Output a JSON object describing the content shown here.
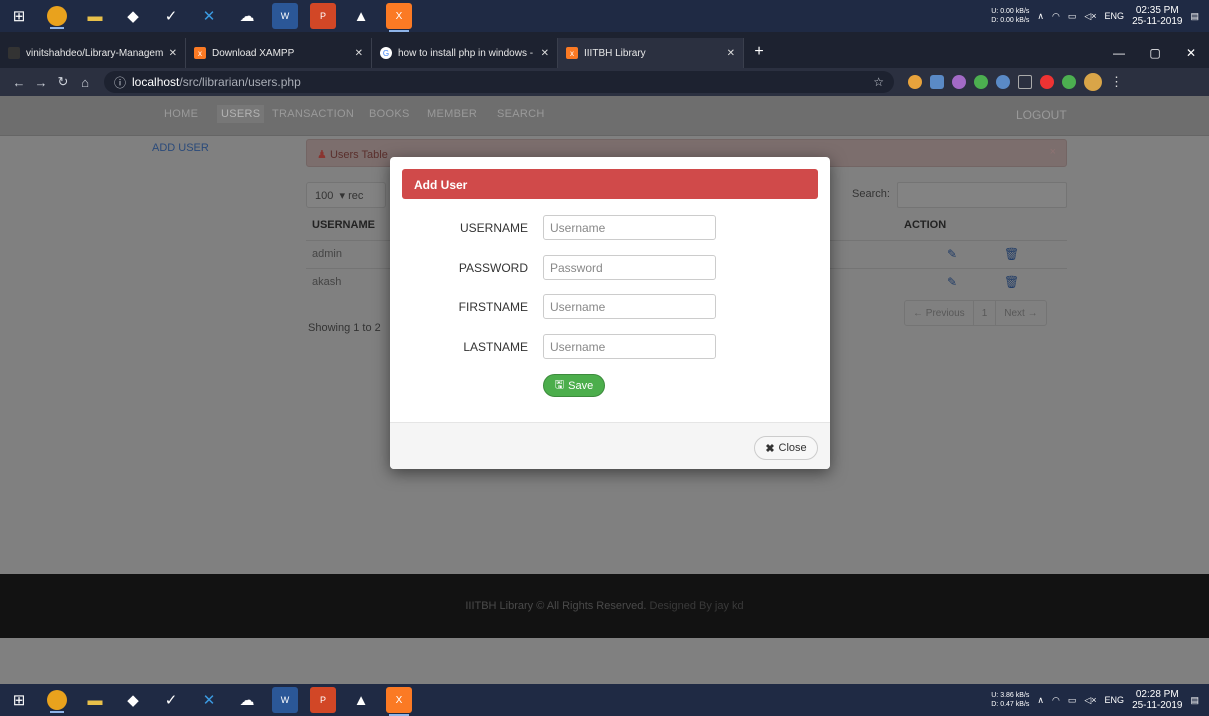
{
  "taskbar_top": {
    "net_up": "0.00 kB/s",
    "net_down": "0.00 kB/s",
    "lang": "ENG",
    "time": "02:35 PM",
    "date": "25-11-2019",
    "icons": [
      "windows-icon",
      "chrome-icon",
      "file-explorer-icon",
      "app-icon",
      "steam-icon",
      "vscode-icon",
      "app2-icon",
      "word-icon",
      "powerpoint-icon",
      "photos-icon",
      "xampp-icon"
    ]
  },
  "taskbar_bottom": {
    "net_up": "3.86 kB/s",
    "net_down": "0.47 kB/s",
    "lang": "ENG",
    "time": "02:28 PM",
    "date": "25-11-2019"
  },
  "tabs": [
    {
      "title": "vinitshahdeo/Library-Manageme",
      "color": "#333333"
    },
    {
      "title": "Download XAMPP",
      "color": "#fb7a24"
    },
    {
      "title": "how to install php in windows - (",
      "color": "#4285f4"
    },
    {
      "title": "IIITBH Library",
      "color": "#fb7a24"
    }
  ],
  "address": {
    "host": "localhost",
    "path": "/src/librarian/users.php"
  },
  "nav": {
    "items": [
      "HOME",
      "USERS",
      "TRANSACTION",
      "BOOKS",
      "MEMBER",
      "SEARCH"
    ],
    "logout": "LOGOUT"
  },
  "sidebar": {
    "add_user": "ADD USER"
  },
  "panel": {
    "title": "Users Table",
    "close": "×"
  },
  "table": {
    "length_value": "100",
    "length_suffix": "rec",
    "search_label": "Search:",
    "headers": {
      "username": "USERNAME",
      "action": "ACTION"
    },
    "rows": [
      {
        "username": "admin"
      },
      {
        "username": "akash"
      }
    ],
    "showing": "Showing 1 to 2",
    "pager": {
      "prev": "← Previous",
      "page": "1",
      "next": "Next →"
    }
  },
  "footer": {
    "text": "IIITBH Library © All Rights Reserved.",
    "designed": "Designed By jay kd"
  },
  "modal": {
    "title": "Add User",
    "fields": [
      {
        "label": "USERNAME",
        "placeholder": "Username"
      },
      {
        "label": "PASSWORD",
        "placeholder": "Password"
      },
      {
        "label": "FIRSTNAME",
        "placeholder": "Username"
      },
      {
        "label": "LASTNAME",
        "placeholder": "Username"
      }
    ],
    "save": "Save",
    "close": "Close"
  }
}
